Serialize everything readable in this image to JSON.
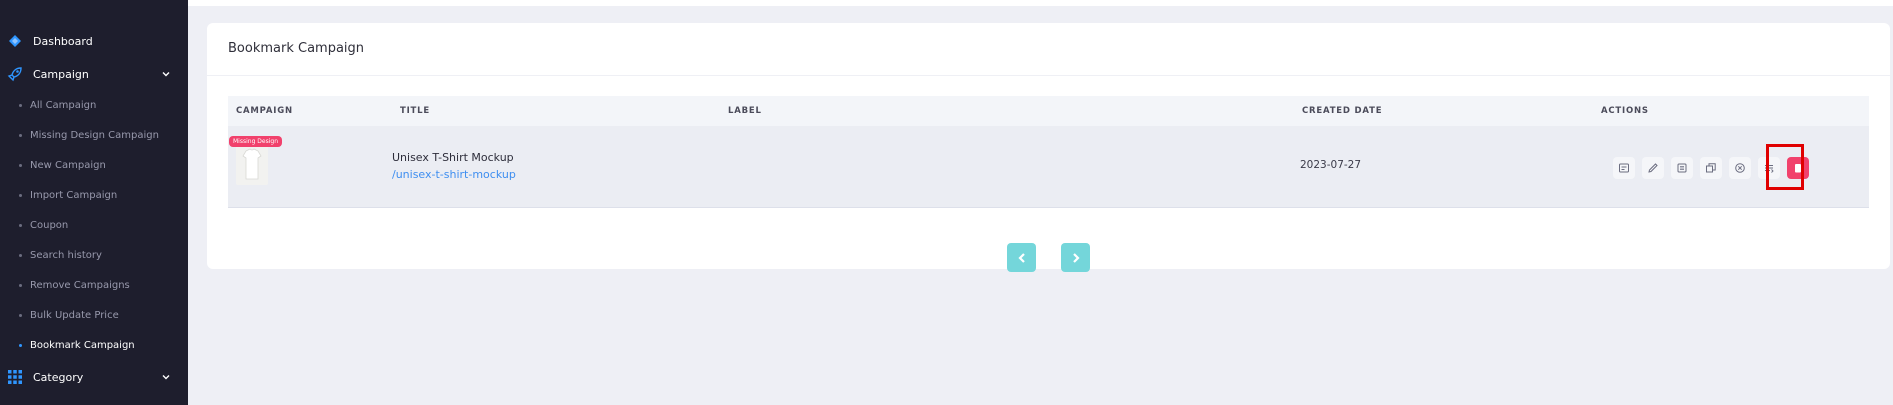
{
  "sidebar": {
    "main_items": [
      {
        "label": "Dashboard",
        "icon": "dashboard-icon"
      },
      {
        "label": "Campaign",
        "icon": "rocket-icon"
      },
      {
        "label": "Category",
        "icon": "grid-icon"
      }
    ],
    "sub_items": [
      {
        "label": "All Campaign"
      },
      {
        "label": "Missing Design Campaign"
      },
      {
        "label": "New Campaign"
      },
      {
        "label": "Import Campaign"
      },
      {
        "label": "Coupon"
      },
      {
        "label": "Search history"
      },
      {
        "label": "Remove Campaigns"
      },
      {
        "label": "Bulk Update Price"
      },
      {
        "label": "Bookmark Campaign",
        "active": true
      }
    ]
  },
  "card": {
    "title": "Bookmark Campaign"
  },
  "table": {
    "headers": {
      "campaign": "CAMPAIGN",
      "title": "TITLE",
      "label": "LABEL",
      "created_date": "CREATED DATE",
      "actions": "ACTIONS"
    },
    "rows": [
      {
        "badge": "Missing Design",
        "title": "Unisex T-Shirt Mockup",
        "slug": "/unisex-t-shirt-mockup",
        "label": "",
        "created_date": "2023-07-27",
        "actions": [
          "design-icon",
          "edit-icon",
          "copy-icon",
          "duplicate-icon",
          "close-circle-icon",
          "list-icon",
          "delete-icon"
        ]
      }
    ]
  },
  "pagination": {
    "prev_icon": "chevron-left-icon",
    "next_icon": "chevron-right-icon"
  },
  "colors": {
    "sidebar_bg": "#1e1e2d",
    "accent": "#2f96ff",
    "danger": "#f1416c",
    "pagination": "#74d6da",
    "link": "#3e8ef0"
  }
}
